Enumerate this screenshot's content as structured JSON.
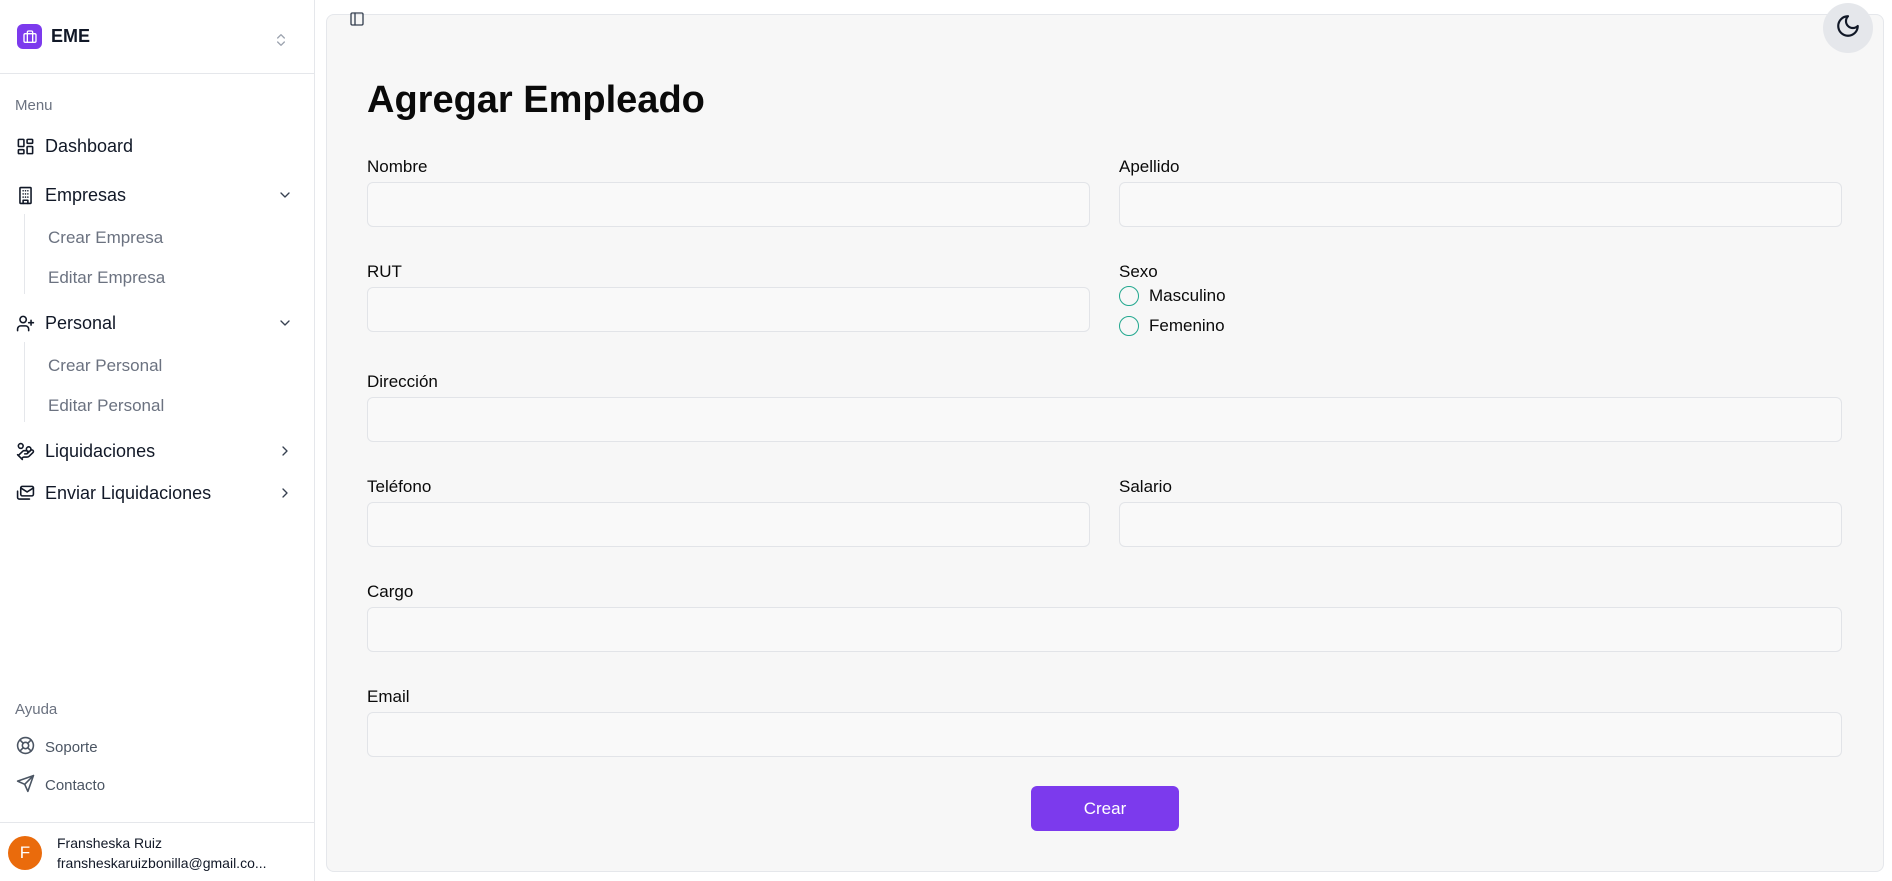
{
  "sidebar": {
    "brand": {
      "name": "EME"
    },
    "menu_label": "Menu",
    "items": [
      {
        "label": "Dashboard",
        "icon": "dashboard-icon"
      },
      {
        "label": "Empresas",
        "icon": "building-icon",
        "expanded": true,
        "children": [
          {
            "label": "Crear Empresa"
          },
          {
            "label": "Editar Empresa"
          }
        ]
      },
      {
        "label": "Personal",
        "icon": "user-plus-icon",
        "expanded": true,
        "children": [
          {
            "label": "Crear Personal"
          },
          {
            "label": "Editar Personal"
          }
        ]
      },
      {
        "label": "Liquidaciones",
        "icon": "hand-coins-icon",
        "expanded": false
      },
      {
        "label": "Enviar Liquidaciones",
        "icon": "mail-stack-icon",
        "expanded": false
      }
    ],
    "help_label": "Ayuda",
    "help_items": [
      {
        "label": "Soporte",
        "icon": "life-buoy-icon"
      },
      {
        "label": "Contacto",
        "icon": "send-icon"
      }
    ],
    "user": {
      "initial": "F",
      "name": "Fransheska Ruiz",
      "email": "fransheskaruizbonilla@gmail.co..."
    }
  },
  "form": {
    "title": "Agregar Empleado",
    "fields": {
      "nombre": {
        "label": "Nombre",
        "value": ""
      },
      "apellido": {
        "label": "Apellido",
        "value": ""
      },
      "rut": {
        "label": "RUT",
        "value": ""
      },
      "sexo": {
        "label": "Sexo",
        "options": [
          "Masculino",
          "Femenino"
        ],
        "selected": null
      },
      "direccion": {
        "label": "Dirección",
        "value": ""
      },
      "telefono": {
        "label": "Teléfono",
        "value": ""
      },
      "salario": {
        "label": "Salario",
        "value": ""
      },
      "cargo": {
        "label": "Cargo",
        "value": ""
      },
      "email": {
        "label": "Email",
        "value": ""
      }
    },
    "submit_label": "Crear"
  },
  "colors": {
    "accent": "#7c3aed",
    "radio_border": "#22a88f",
    "avatar": "#ea6b0c",
    "panel_bg": "#f7f7f7"
  },
  "icons": {
    "brand": "briefcase-icon",
    "brand_switch": "chevrons-up-down-icon",
    "panel_toggle": "panel-left-icon",
    "theme": "moon-icon"
  }
}
